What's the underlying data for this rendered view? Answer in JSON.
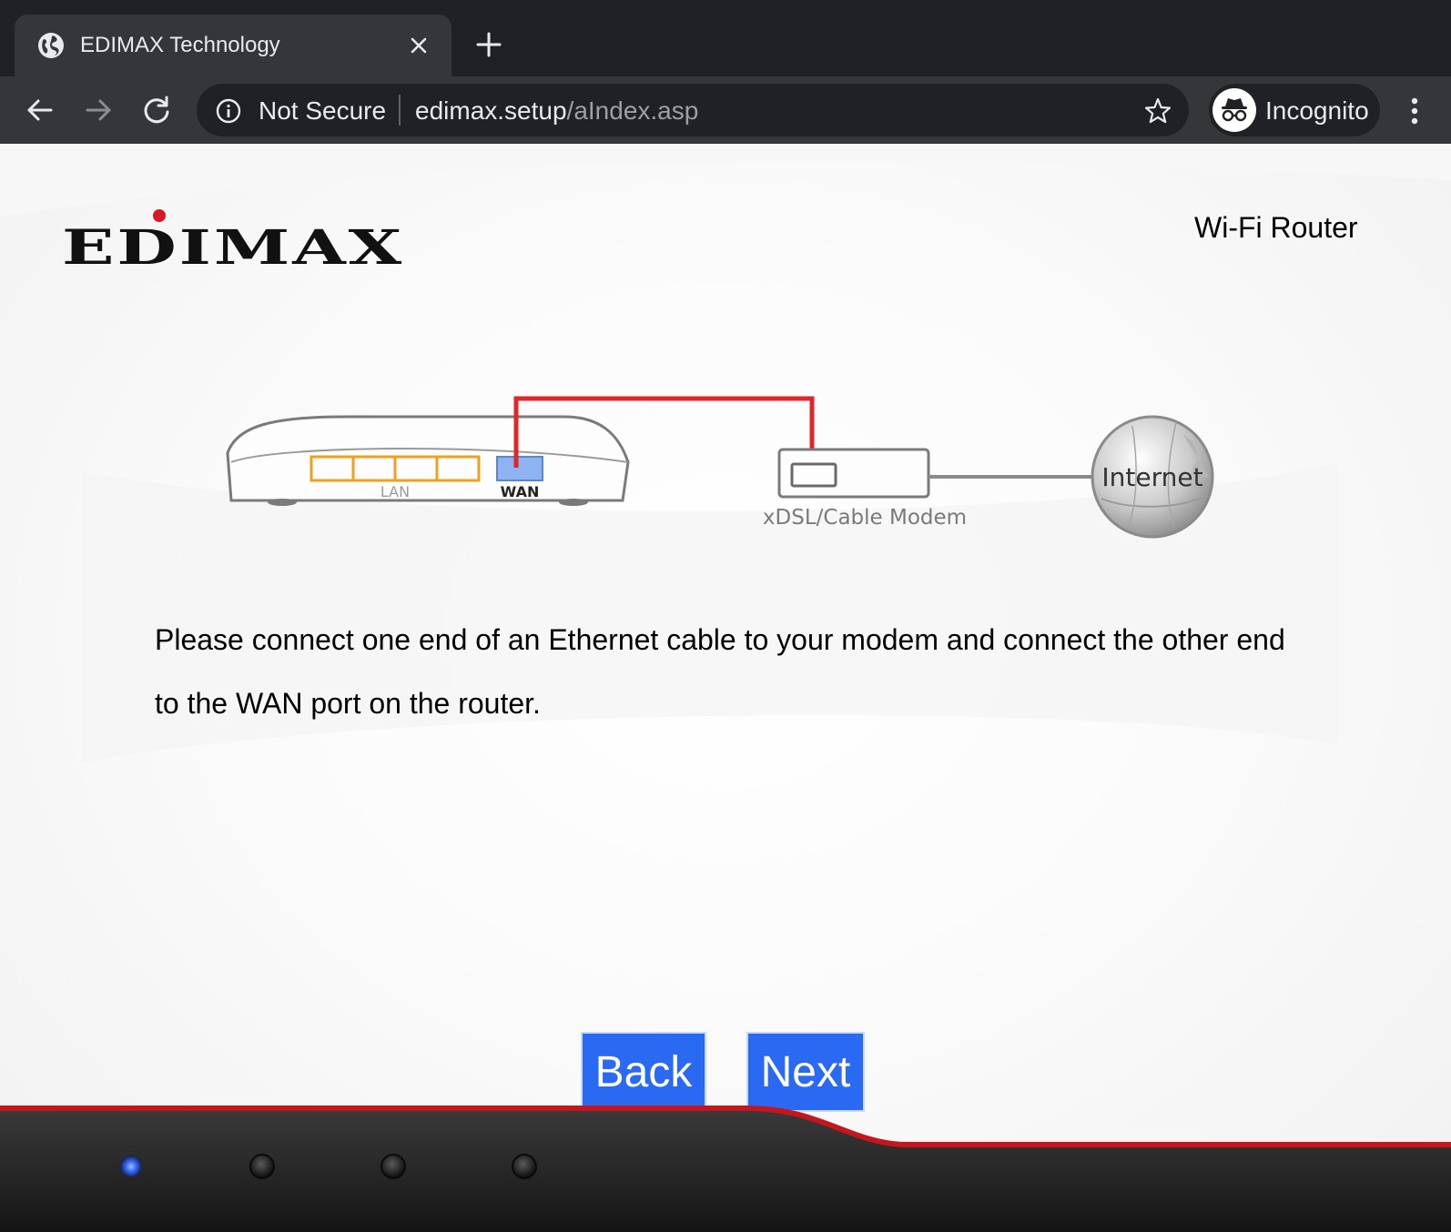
{
  "browser": {
    "tab": {
      "title": "EDIMAX Technology"
    },
    "toolbar": {
      "security_label": "Not Secure",
      "url_host": "edimax.setup",
      "url_path": "/aIndex.asp",
      "incognito_label": "Incognito"
    }
  },
  "page": {
    "logo": {
      "text": "EDIMAX"
    },
    "product_name": "Wi-Fi Router",
    "diagram": {
      "lan_label": "LAN",
      "wan_label": "WAN",
      "modem_label": "xDSL/Cable Modem",
      "internet_label": "Internet",
      "colors": {
        "cable": "#e0262b",
        "lan_ports": "#f0a020",
        "wan_port": "#8db4f0",
        "device_outline": "#7a7a7a"
      }
    },
    "instructions": {
      "line1": "Please connect one end of an Ethernet cable to your modem and connect the other end",
      "line2": "to the WAN port on the router."
    },
    "buttons": {
      "back": "Back",
      "next": "Next"
    },
    "colors": {
      "button_bg": "#2a6af2",
      "accent_red": "#d71921",
      "led_active": "#3a6bff"
    }
  }
}
